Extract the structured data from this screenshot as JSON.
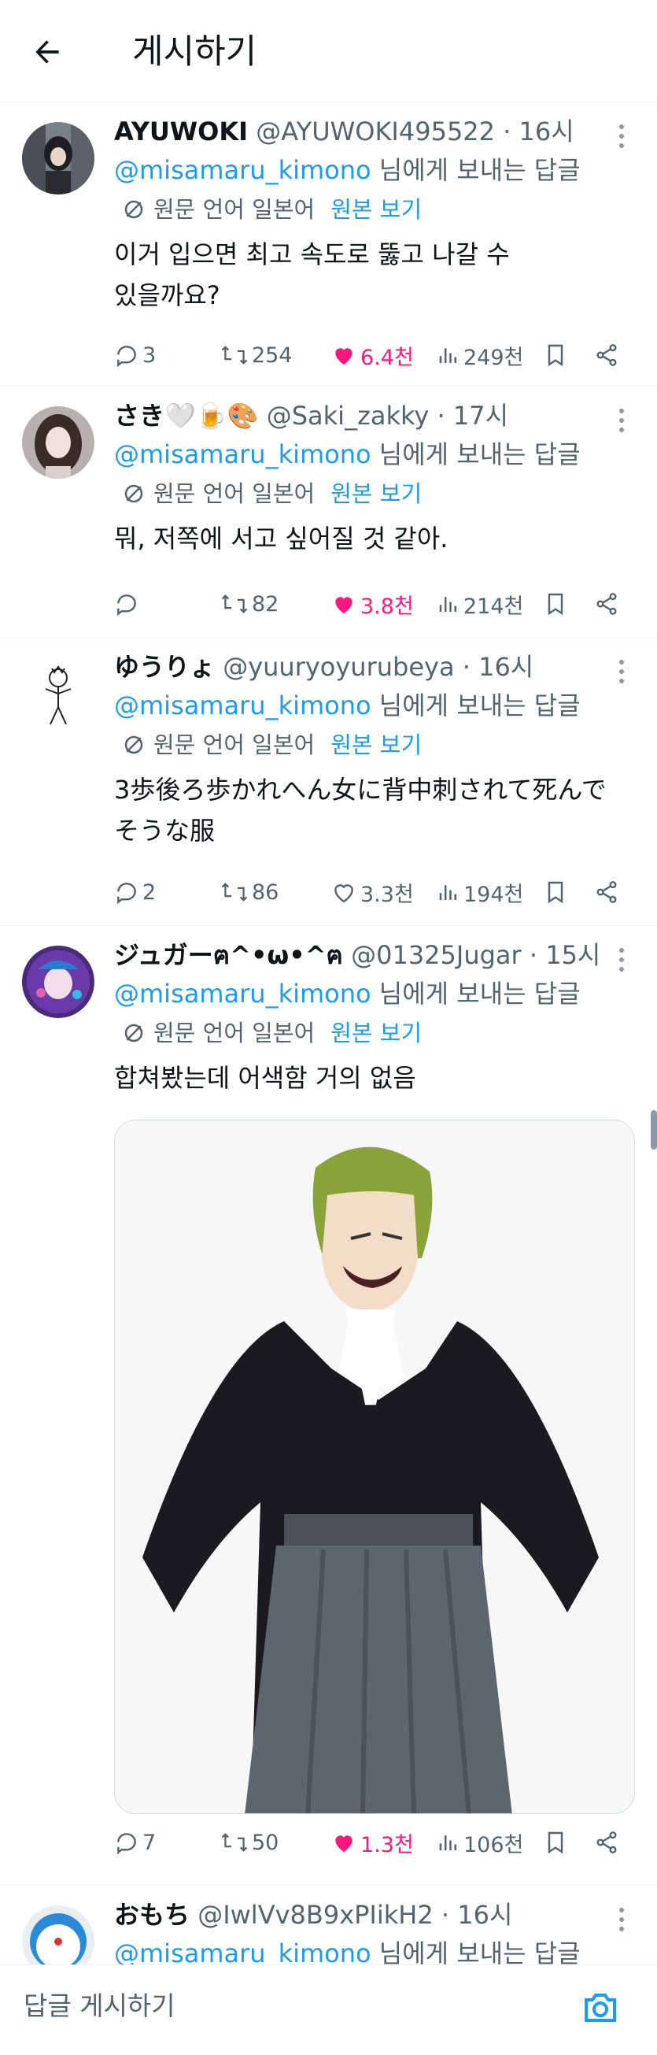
{
  "header": {
    "title": "게시하기"
  },
  "tweets": [
    {
      "name": "AYUWOKI",
      "handle": "@AYUWOKI495522",
      "time": "· 16시",
      "mention": "@misamaru_kimono",
      "reply_suffix": " 님에게 보내는 답글",
      "translate_label": "원문 언어 일본어",
      "original_link": "원본 보기",
      "text": "이거 입으면 최고 속도로 뚫고 나갈 수 있을까요?",
      "replies": "3",
      "reposts": "254",
      "likes": "6.4천",
      "views": "249천",
      "liked": true
    },
    {
      "name": "さき🤍🍺🎨",
      "handle": "@Saki_zakky",
      "time": "· 17시",
      "mention": "@misamaru_kimono",
      "reply_suffix": " 님에게 보내는 답글",
      "translate_label": "원문 언어 일본어",
      "original_link": "원본 보기",
      "text": "뭐, 저쪽에 서고 싶어질 것 같아.",
      "replies": "",
      "reposts": "82",
      "likes": "3.8천",
      "views": "214천",
      "liked": true
    },
    {
      "name": "ゆうりょ",
      "handle": "@yuuryoyurubeya",
      "time": "· 16시",
      "mention": "@misamaru_kimono",
      "reply_suffix": " 님에게 보내는 답글",
      "translate_label": "원문 언어 일본어",
      "original_link": "원본 보기",
      "text": "3歩後ろ歩かれへん女に背中刺されて死んでそうな服",
      "replies": "2",
      "reposts": "86",
      "likes": "3.3천",
      "views": "194천",
      "liked": false
    },
    {
      "name": "ジュガーฅ^•ω•^ฅ",
      "handle": "@01325Jugar",
      "time": "· 15시",
      "mention": "@misamaru_kimono",
      "reply_suffix": " 님에게 보내는 답글",
      "translate_label": "원문 언어 일본어",
      "original_link": "원본 보기",
      "text": "합쳐봤는데 어색함 거의 없음",
      "replies": "7",
      "reposts": "50",
      "likes": "1.3천",
      "views": "106천",
      "liked": true
    },
    {
      "name": "おもち",
      "handle": "@IwlVv8B9xPIikH2",
      "time": "· 16시",
      "mention": "@misamaru_kimono",
      "reply_suffix": " 님에게 보내는 답글"
    }
  ],
  "compose": {
    "placeholder": "답글 게시하기"
  },
  "colors": {
    "accent": "#1d9bf0",
    "like": "#f91880",
    "muted": "#536471"
  },
  "icons": [
    "back-arrow-icon",
    "more-icon",
    "translate-icon",
    "reply-icon",
    "repost-icon",
    "like-icon",
    "views-icon",
    "bookmark-icon",
    "share-icon",
    "camera-icon"
  ]
}
